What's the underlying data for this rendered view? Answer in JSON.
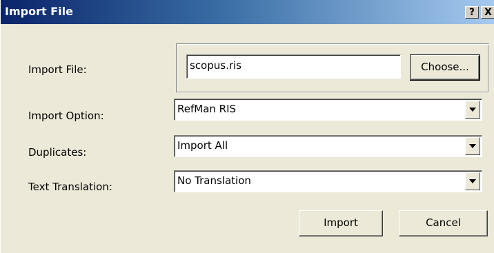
{
  "window": {
    "title": "Import File",
    "help_label": "?",
    "close_label": "X"
  },
  "form": {
    "import_file": {
      "label": "Import File:",
      "value": "scopus.ris",
      "choose_label": "Choose..."
    },
    "import_option": {
      "label": "Import Option:",
      "value": "RefMan RIS"
    },
    "duplicates": {
      "label": "Duplicates:",
      "value": "Import All"
    },
    "text_translation": {
      "label": "Text Translation:",
      "value": "No Translation"
    }
  },
  "buttons": {
    "import_label": "Import",
    "cancel_label": "Cancel"
  },
  "icons": {
    "dropdown": "chevron-down-icon"
  },
  "colors": {
    "titlebar_start": "#0a246a",
    "titlebar_end": "#a6caf0",
    "dialog_bg": "#ece9d8"
  }
}
